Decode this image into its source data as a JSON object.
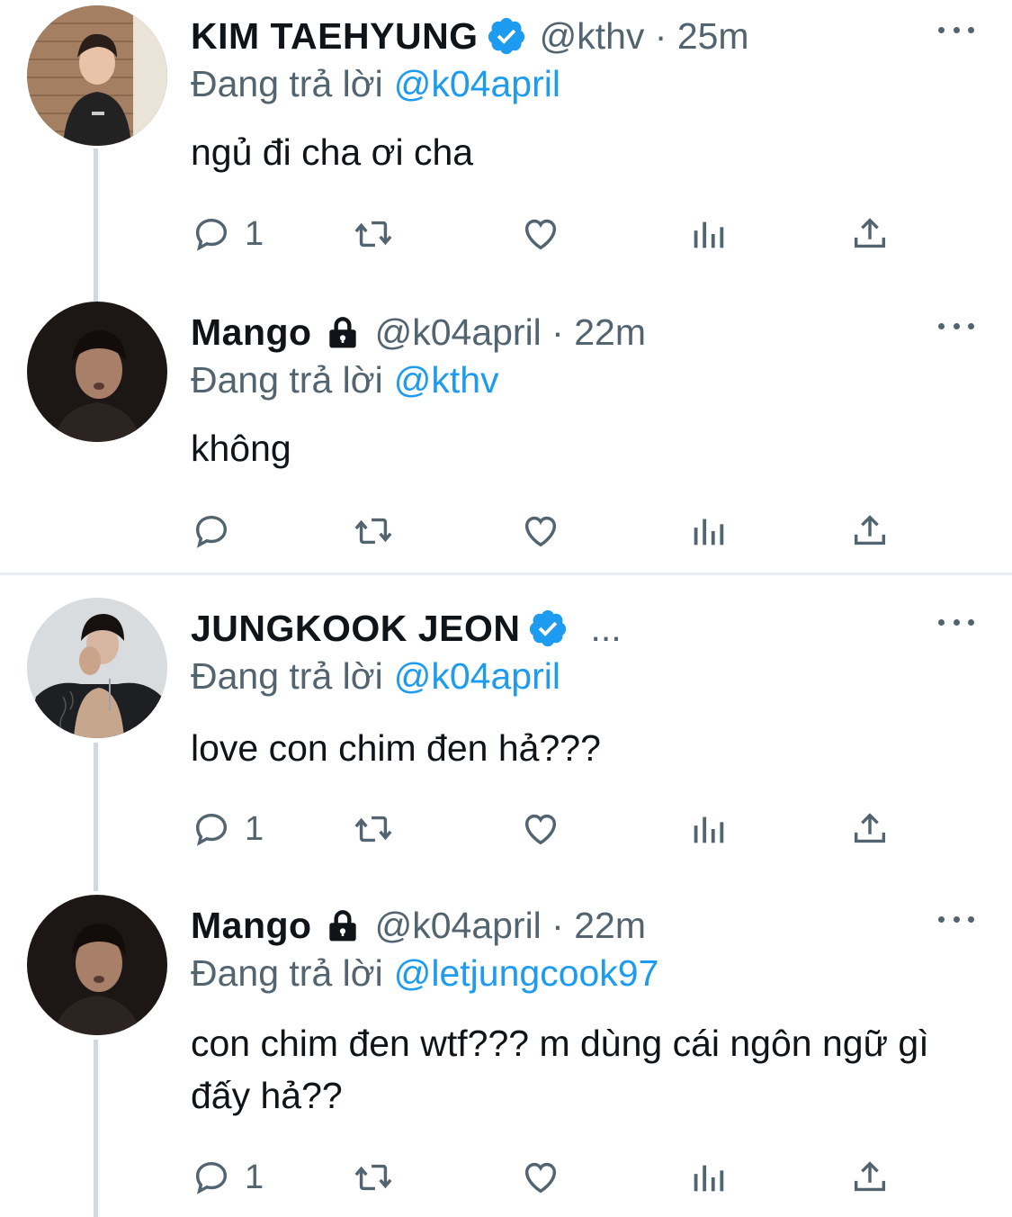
{
  "colors": {
    "link": "#1d9bf0",
    "muted": "#536471",
    "text": "#0f1419",
    "verified": "#1d9bf0"
  },
  "tweets": [
    {
      "name": "KIM TAEHYUNG",
      "badge": "verified-icon",
      "meta": "@kthv · 25m",
      "reply_label": "Đang trả lời",
      "reply_to": "@k04april",
      "text": "ngủ đi cha ơi cha",
      "reply_count": "1"
    },
    {
      "name": "Mango",
      "badge": "lock-icon",
      "meta": "@k04april · 22m",
      "reply_label": "Đang trả lời",
      "reply_to": "@kthv",
      "text": "không",
      "reply_count": ""
    },
    {
      "name": "JUNGKOOK JEON",
      "badge": "verified-icon",
      "meta": "...",
      "reply_label": "Đang trả lời",
      "reply_to": "@k04april",
      "text": "love con chim đen hả???",
      "reply_count": "1"
    },
    {
      "name": "Mango",
      "badge": "lock-icon",
      "meta": "@k04april · 22m",
      "reply_label": "Đang trả lời",
      "reply_to": "@letjungcook97",
      "text": "con chim đen wtf??? m dùng cái ngôn ngữ gì đấy hả??",
      "reply_count": "1"
    }
  ]
}
